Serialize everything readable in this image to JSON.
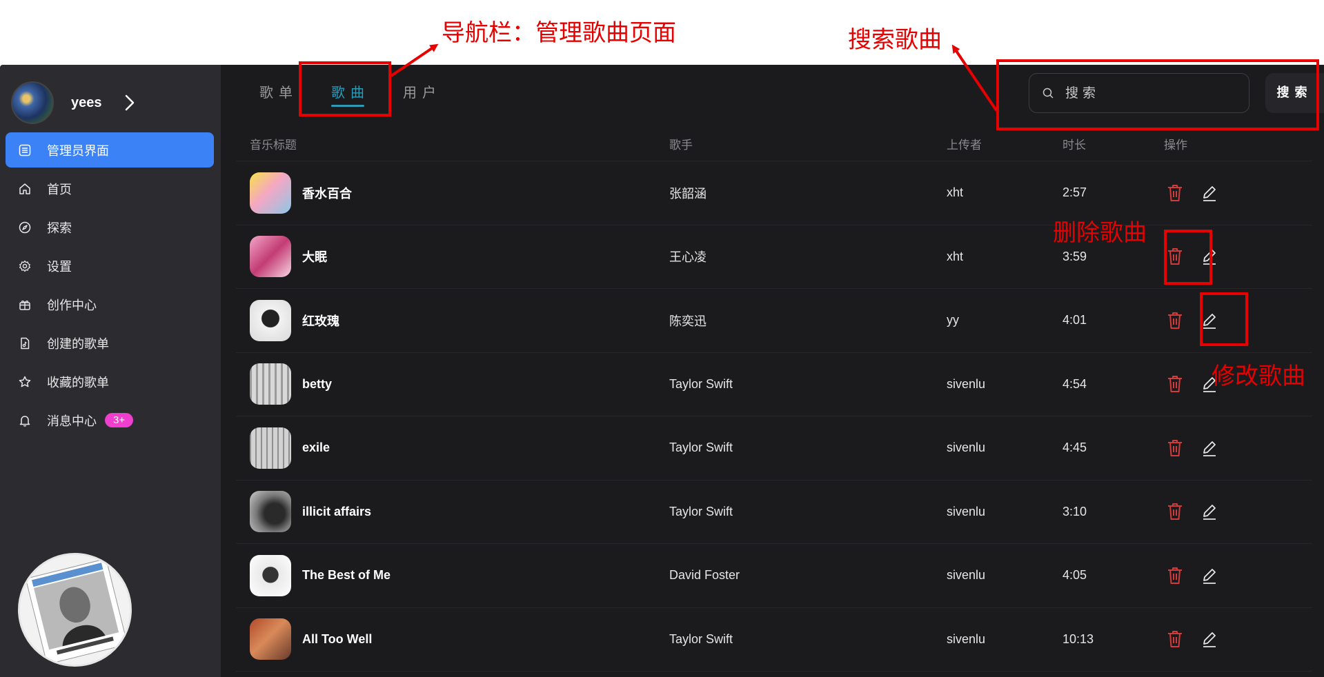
{
  "annotations": {
    "nav_label": "导航栏：管理歌曲页面",
    "search_label": "搜索歌曲",
    "delete_label": "删除歌曲",
    "edit_label": "修改歌曲",
    "color": "#e60000"
  },
  "sidebar": {
    "username": "yees",
    "items": [
      {
        "label": "管理员界面",
        "icon": "list-icon",
        "active": true
      },
      {
        "label": "首页",
        "icon": "home-icon"
      },
      {
        "label": "探索",
        "icon": "compass-icon"
      },
      {
        "label": "设置",
        "icon": "gear-icon"
      },
      {
        "label": "创作中心",
        "icon": "gift-icon"
      },
      {
        "label": "创建的歌单",
        "icon": "music-file-icon"
      },
      {
        "label": "收藏的歌单",
        "icon": "star-icon"
      },
      {
        "label": "消息中心",
        "icon": "bell-icon",
        "badge": "3+"
      }
    ],
    "active_color": "#3b82f6"
  },
  "tabs": [
    {
      "label": "歌单"
    },
    {
      "label": "歌曲",
      "active": true
    },
    {
      "label": "用户"
    }
  ],
  "search": {
    "placeholder": "搜索",
    "button_label": "搜索"
  },
  "table": {
    "headers": {
      "title": "音乐标题",
      "artist": "歌手",
      "uploader": "上传者",
      "duration": "时长",
      "actions": "操作"
    },
    "rows": [
      {
        "title": "香水百合",
        "artist": "张韶涵",
        "uploader": "xht",
        "duration": "2:57"
      },
      {
        "title": "大眠",
        "artist": "王心凌",
        "uploader": "xht",
        "duration": "3:59"
      },
      {
        "title": "红玫瑰",
        "artist": "陈奕迅",
        "uploader": "yy",
        "duration": "4:01"
      },
      {
        "title": "betty",
        "artist": "Taylor Swift",
        "uploader": "sivenlu",
        "duration": "4:54"
      },
      {
        "title": "exile",
        "artist": "Taylor Swift",
        "uploader": "sivenlu",
        "duration": "4:45"
      },
      {
        "title": "illicit affairs",
        "artist": "Taylor Swift",
        "uploader": "sivenlu",
        "duration": "3:10"
      },
      {
        "title": "The Best of Me",
        "artist": "David Foster",
        "uploader": "sivenlu",
        "duration": "4:05"
      },
      {
        "title": "All Too Well",
        "artist": "Taylor Swift",
        "uploader": "sivenlu",
        "duration": "10:13"
      }
    ]
  },
  "colors": {
    "delete_icon": "#d23b3b",
    "tab_active": "#2b9bb8",
    "badge": "#f03ecf"
  }
}
